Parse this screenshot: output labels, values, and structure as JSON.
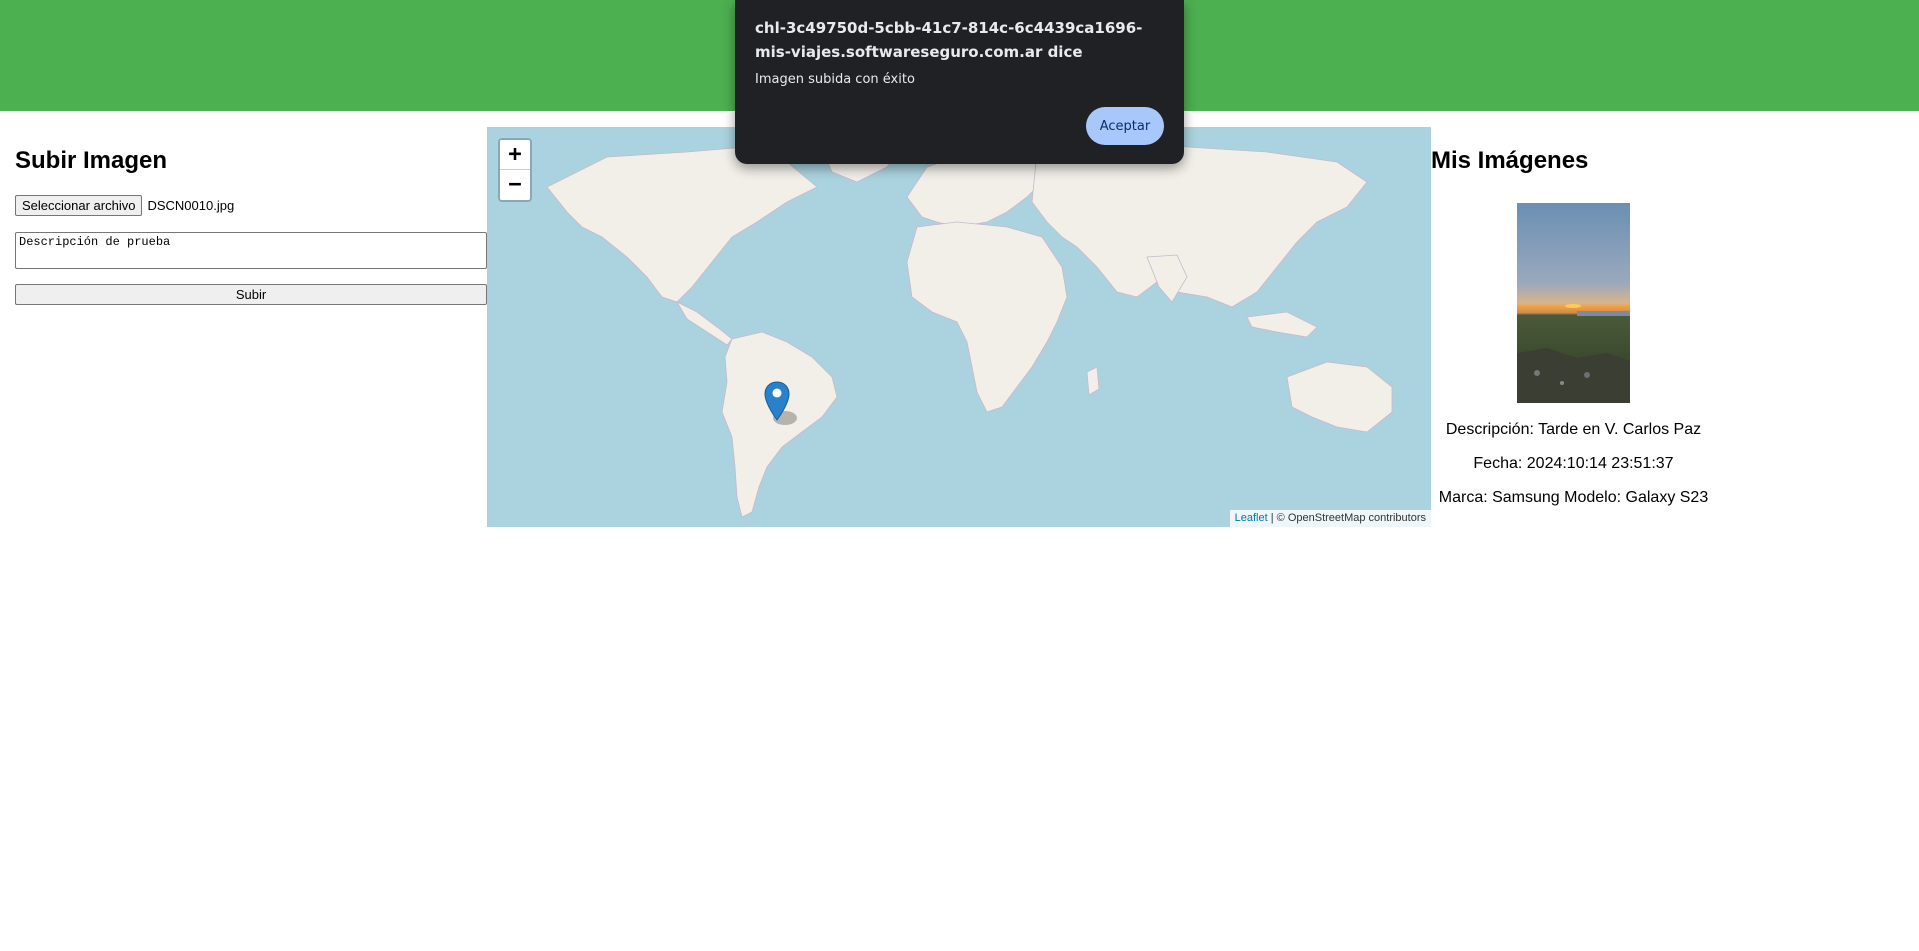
{
  "colors": {
    "header": "#4caf50",
    "ocean": "#aad3df",
    "land": "#f2efe9",
    "border": "#b8a8b8",
    "marker": "#2a81cb"
  },
  "upload": {
    "title": "Subir Imagen",
    "file_button": "Seleccionar archivo",
    "file_name": "DSCN0010.jpg",
    "description_value": "Descripción de prueba",
    "submit_label": "Subir"
  },
  "map": {
    "zoom_in": "+",
    "zoom_out": "−",
    "attribution_link": "Leaflet",
    "attribution_separator": " | ",
    "attribution_text": "© OpenStreetMap contributors",
    "marker_icon": "map-marker-icon"
  },
  "images": {
    "title": "Mis Imágenes",
    "items": [
      {
        "description": "Descripción: Tarde en V. Carlos Paz",
        "date": "Fecha: 2024:10:14 23:51:37",
        "device": "Marca: Samsung Modelo: Galaxy S23"
      }
    ]
  },
  "dialog": {
    "title": "chl-3c49750d-5cbb-41c7-814c-6c4439ca1696-mis-viajes.softwareseguro.com.ar dice",
    "message": "Imagen subida con éxito",
    "ok_label": "Aceptar"
  }
}
